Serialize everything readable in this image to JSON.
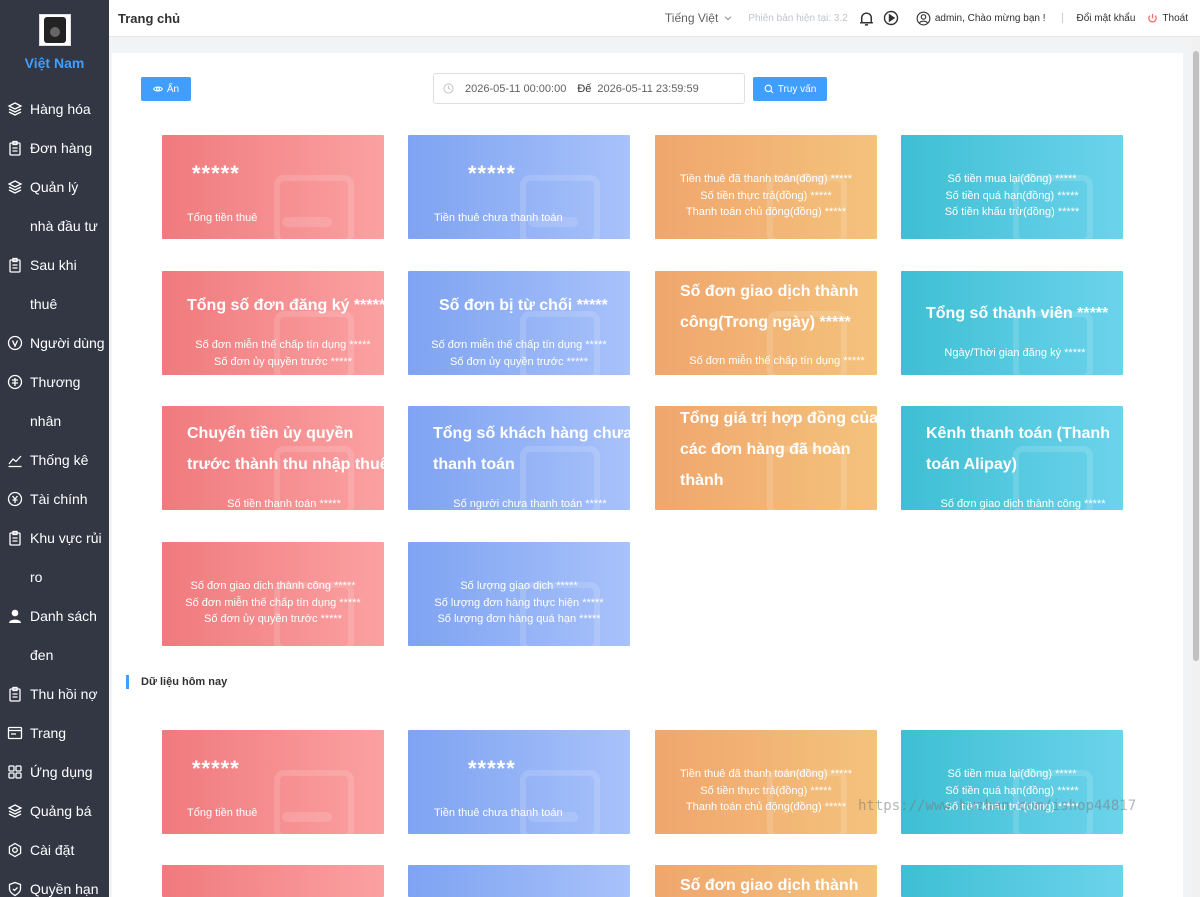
{
  "sidebar": {
    "brand": "Việt Nam",
    "items": [
      {
        "label": "Hàng hóa"
      },
      {
        "label": "Đơn hàng"
      },
      {
        "label": "Quản lý nhà đầu tư"
      },
      {
        "label": "Sau khi thuê"
      },
      {
        "label": "Người dùng"
      },
      {
        "label": "Thương nhân"
      },
      {
        "label": "Thống kê"
      },
      {
        "label": "Tài chính"
      },
      {
        "label": "Khu vực rủi ro"
      },
      {
        "label": "Danh sách đen"
      },
      {
        "label": "Thu hồi nợ"
      },
      {
        "label": "Trang"
      },
      {
        "label": "Ứng dụng"
      },
      {
        "label": "Quảng bá"
      },
      {
        "label": "Cài đặt"
      },
      {
        "label": "Quyền hạn"
      }
    ]
  },
  "header": {
    "title": "Trang chủ",
    "language": "Tiếng Việt",
    "version_label": "Phiên bản hiện tại:",
    "version_value": "3.2",
    "user_name": "admin",
    "welcome": "Chào mừng bạn !",
    "change_password": "Đổi mật khẩu",
    "logout": "Thoát"
  },
  "toolbar": {
    "hide_label": "Ẩn",
    "date_start": "2026-05-11 00:00:00",
    "date_separator": "Đế",
    "date_end": "2026-05-11 23:59:59",
    "query_label": "Truy vấn"
  },
  "cards": {
    "c1": {
      "value": "*****",
      "label": "Tổng tiền thuê"
    },
    "c2": {
      "value": "*****",
      "label": "Tiền thuê chưa thanh toán"
    },
    "c3": {
      "l1": "Tiền thuê đã thanh toán(đồng) *****",
      "l2": "Số tiền thực trả(đồng) *****",
      "l3": "Thanh toán chủ động(đồng) *****"
    },
    "c4": {
      "l1": "Số tiền mua lại(đồng) *****",
      "l2": "Số tiền quá hạn(đồng) *****",
      "l3": "Số tiền khấu trừ(đồng) *****"
    },
    "c5": {
      "title": "Tổng số đơn đăng ký *****",
      "l1": "Số đơn miễn thế chấp tín dụng *****",
      "l2": "Số đơn ủy quyền trước *****"
    },
    "c6": {
      "title": "Số đơn bị từ chối *****",
      "l1": "Số đơn miễn thế chấp tín dụng *****",
      "l2": "Số đơn ủy quyền trước *****"
    },
    "c7": {
      "title1": "Số đơn giao dịch thành",
      "title2": "công(Trong ngày) *****",
      "l1": "Số đơn miễn thế chấp tín dụng *****"
    },
    "c8": {
      "title": "Tổng số thành viên *****",
      "l1": "Ngày/Thời gian đăng ký *****"
    },
    "c9": {
      "title1": "Chuyển tiền ủy quyền",
      "title2": "trước thành thu nhập thuê",
      "l1": "Số tiền thanh toán *****"
    },
    "c10": {
      "title1": "Tổng số khách hàng chưa",
      "title2": "thanh toán",
      "l1": "Số người chưa thanh toán *****"
    },
    "c11": {
      "title1": "Tổng giá trị hợp đồng của",
      "title2": "các đơn hàng đã hoàn",
      "title3": "thành"
    },
    "c12": {
      "title1": "Kênh thanh toán (Thanh",
      "title2": "toán Alipay)",
      "l1": "Số đơn giao dịch thành công *****"
    },
    "c13": {
      "l1": "Số đơn giao dịch thành công *****",
      "l2": "Số đơn miễn thế chấp tín dụng *****",
      "l3": "Số đơn ủy quyền trước *****"
    },
    "c14": {
      "l1": "Số lượng giao dịch *****",
      "l2": "Số lượng đơn hàng thực hiện *****",
      "l3": "Số lượng đơn hàng quá hạn *****"
    }
  },
  "today": {
    "section_title": "Dữ liệu hôm nay",
    "t1": {
      "value": "*****",
      "label": "Tổng tiền thuê"
    },
    "t2": {
      "value": "*****",
      "label": "Tiền thuê chưa thanh toán"
    },
    "t3": {
      "l1": "Tiền thuê đã thanh toán(đồng) *****",
      "l2": "Số tiền thực trả(đồng) *****",
      "l3": "Thanh toán chủ động(đồng) *****"
    },
    "t4": {
      "l1": "Số tiền mua lại(đồng) *****",
      "l2": "Số tiền quá hạn(đồng) *****",
      "l3": "Số tiền khấu trừ(đồng) *****"
    },
    "t7": {
      "title1": "Số đơn giao dịch thành"
    }
  },
  "watermark": "https://www.huzhan.com/ishop44817",
  "colors": {
    "accent": "#409eff",
    "sidebar": "#333744",
    "red": "#f07a7d",
    "blue": "#7fa3f2",
    "orange": "#f0a66d",
    "teal": "#3ebfd3"
  }
}
